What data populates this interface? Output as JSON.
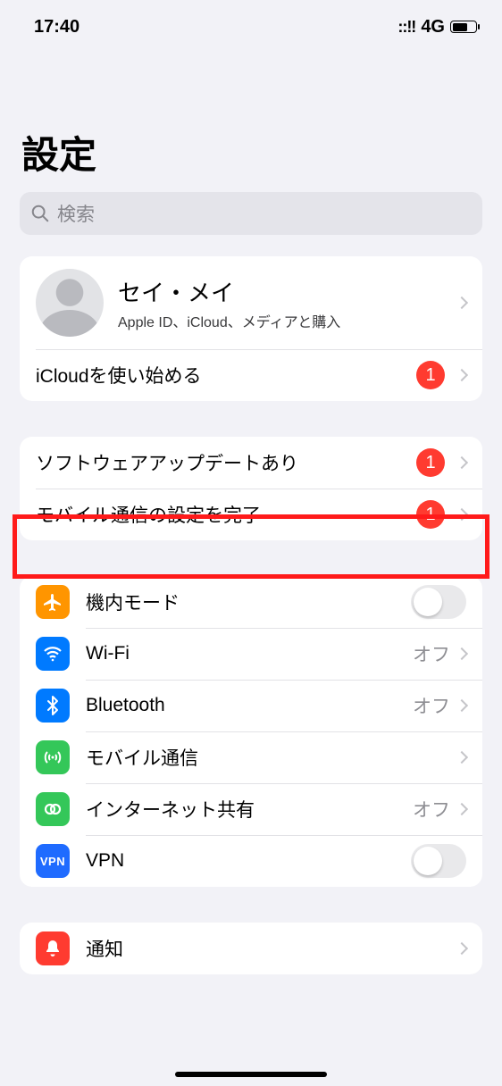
{
  "status": {
    "time": "17:40",
    "signal": "::!!",
    "net": "4G"
  },
  "title": "設定",
  "search": {
    "placeholder": "検索"
  },
  "profile": {
    "name": "セイ・メイ",
    "subtitle": "Apple ID、iCloud、メディアと購入"
  },
  "icloud_row": {
    "label": "iCloudを使い始める",
    "badge": "1"
  },
  "alerts": [
    {
      "label": "ソフトウェアアップデートあり",
      "badge": "1"
    },
    {
      "label": "モバイル通信の設定を完了",
      "badge": "1"
    }
  ],
  "settings": [
    {
      "icon": "airplane",
      "label": "機内モード",
      "accessory": "toggle"
    },
    {
      "icon": "wifi",
      "label": "Wi-Fi",
      "value": "オフ",
      "accessory": "chevron"
    },
    {
      "icon": "bluetooth",
      "label": "Bluetooth",
      "value": "オフ",
      "accessory": "chevron"
    },
    {
      "icon": "cellular",
      "label": "モバイル通信",
      "accessory": "chevron"
    },
    {
      "icon": "hotspot",
      "label": "インターネット共有",
      "value": "オフ",
      "accessory": "chevron"
    },
    {
      "icon": "vpn",
      "label": "VPN",
      "accessory": "toggle"
    }
  ],
  "notifications_row": {
    "label": "通知"
  }
}
